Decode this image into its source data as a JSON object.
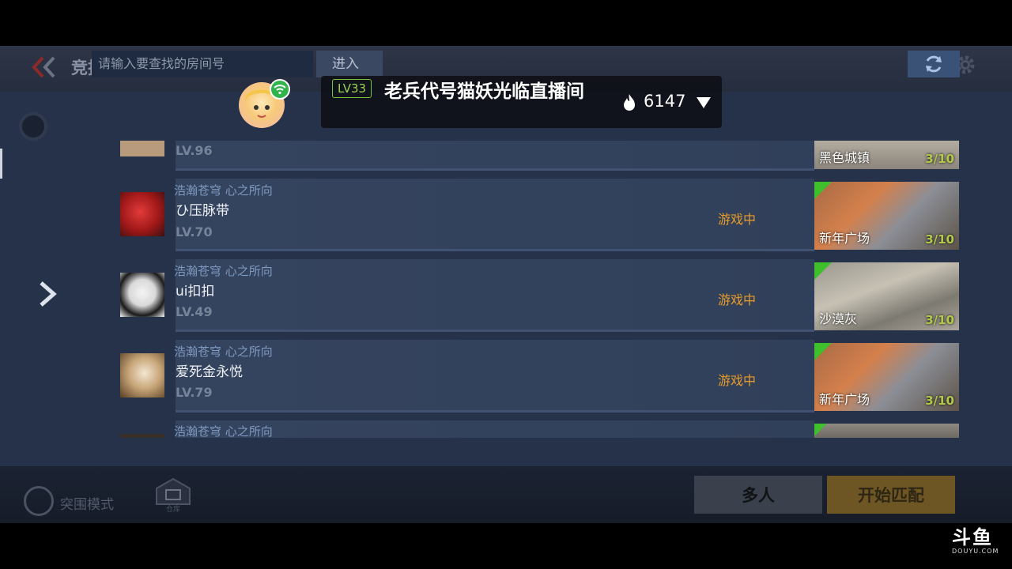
{
  "header": {
    "title": "竞技"
  },
  "search": {
    "placeholder": "请输入要查找的房间号",
    "enter_label": "进入"
  },
  "stream_overlay": {
    "level": "LV33",
    "title": "老兵代号猫妖光临直播间",
    "hot_count": "6147"
  },
  "rooms": [
    {
      "clan": "",
      "name": "",
      "level": "LV.96",
      "status": "",
      "map": "黑色城镇",
      "players": "3/10"
    },
    {
      "clan": "浩瀚苍穹 心之所向",
      "name": "ひ压脉带",
      "level": "LV.70",
      "status": "游戏中",
      "map": "新年广场",
      "players": "3/10"
    },
    {
      "clan": "浩瀚苍穹 心之所向",
      "name": "ui扣扣",
      "level": "LV.49",
      "status": "游戏中",
      "map": "沙漠灰",
      "players": "3/10"
    },
    {
      "clan": "浩瀚苍穹 心之所向",
      "name": "爱死金永悦",
      "level": "LV.79",
      "status": "游戏中",
      "map": "新年广场",
      "players": "3/10"
    },
    {
      "clan": "浩瀚苍穹 心之所向",
      "name": "",
      "level": "",
      "status": "",
      "map": "",
      "players": ""
    }
  ],
  "bottom": {
    "mode_label": "突围模式",
    "warehouse_label": "仓库",
    "multi_label": "多人",
    "match_label": "开始匹配"
  },
  "watermark": {
    "cn": "斗鱼",
    "en": "DOUYU.COM"
  },
  "colors": {
    "status": "#e89b2a",
    "accent_green": "#3fbf2c",
    "panel": "#25324a"
  }
}
